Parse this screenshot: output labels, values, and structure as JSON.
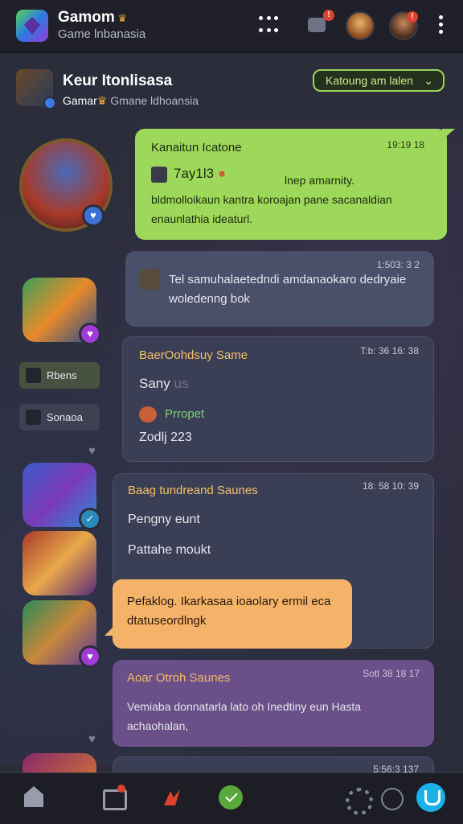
{
  "app": {
    "name": "Gamom",
    "subtitle": "Game lnbanasia"
  },
  "topbar": {
    "chat_badge": "!",
    "avatar1_badge": "",
    "avatar2_badge": "!"
  },
  "channel": {
    "name": "Keur Itonlisasa",
    "sub_prefix": "Gamar",
    "sub_suffix": "Gmane ldhoansia",
    "join_label": "Katoung am lalen"
  },
  "sidebar": {
    "chips": [
      {
        "label": "Rbens"
      },
      {
        "label": "Sonaoa"
      }
    ]
  },
  "messages": [
    {
      "sender": "Kanaitun Icatone",
      "time": "19:19 18",
      "handle": "7ay1l3",
      "tag": "lnep amarnity.",
      "text": "bldmolloikaun kantra koroajan pane sacanaldian enaunlathia ideaturl."
    },
    {
      "time": "1:503: 3 2",
      "text": "Tel samuhalaetedndi amdanaokaro dedryaie woledenng bok"
    },
    {
      "sender": "BaerOohdsuy Same",
      "time": "T:b: 36 16: 38",
      "line1": "Sany",
      "line1_dim": "us",
      "line2": "Prropet",
      "line3": "Zodlj 223"
    },
    {
      "sender": "Baag tundreand Saunes",
      "time": "18: 58 10: 39",
      "line1": "Pengny eunt",
      "line2": "Pattahe moukt"
    },
    {
      "text": "Pefaklog. Ikarkasaa ioaolary ermil eca dtatuseordlngk"
    },
    {
      "sender": "Aoar Otroh Saunes",
      "time": "Sotl 38 18 17",
      "text": "Vemiaba donnatarla lato oh Inedtiny eun Hasta achaohalan,"
    },
    {
      "time": "5:56:3 137"
    }
  ],
  "colors": {
    "background": "#2b2d3a",
    "accent_green": "#9dd85a",
    "accent_orange": "#f5b36a",
    "accent_purple": "#6a4f88",
    "cta_blue": "#1ab0e8"
  },
  "icons": [
    "app-logo-icon",
    "grid-icon",
    "chat-icon",
    "more-vertical-icon",
    "home-icon",
    "image-icon",
    "flame-icon",
    "check-icon",
    "settings-icon",
    "compass-icon",
    "shield-icon"
  ]
}
